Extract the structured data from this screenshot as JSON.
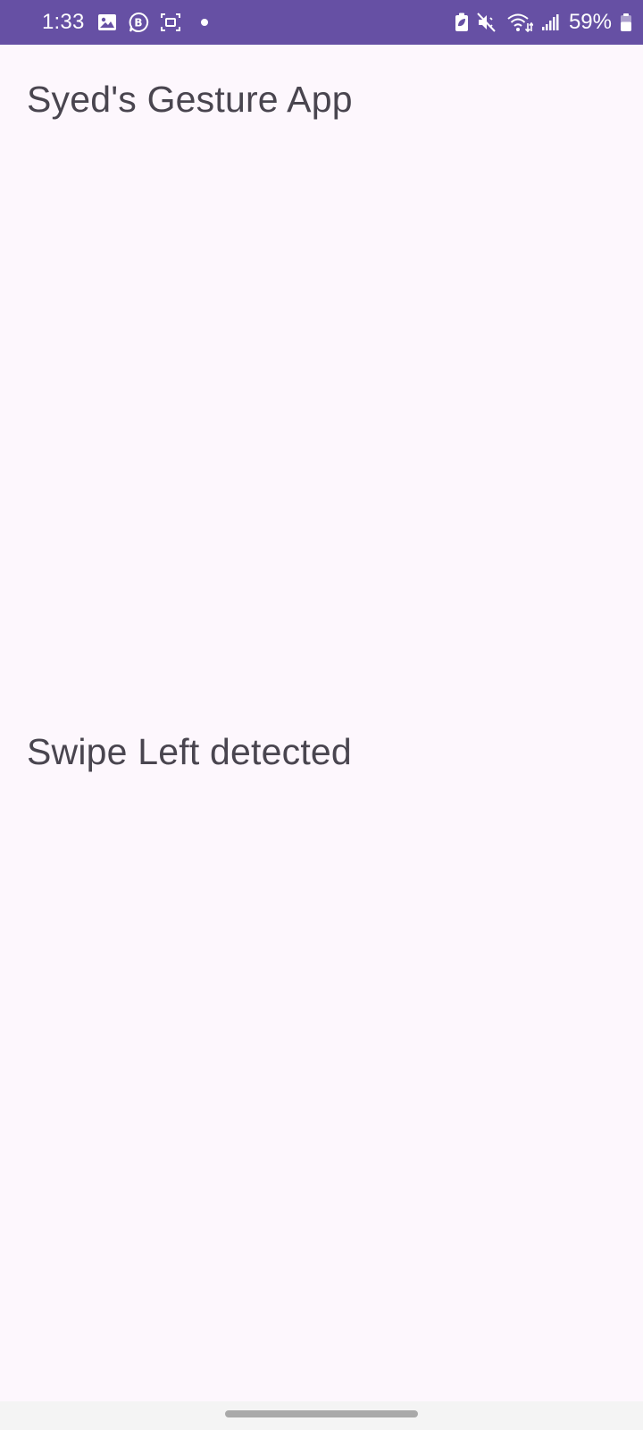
{
  "status_bar": {
    "time": "1:33",
    "battery_percent": "59%",
    "bg_color": "#6650a4",
    "left_icons": [
      "gallery-icon",
      "business-b-icon",
      "screen-capture-icon",
      "notification-dot-icon"
    ],
    "right_icons": [
      "battery-saver-icon",
      "mute-icon",
      "wifi-icon",
      "signal-icon",
      "battery-icon"
    ]
  },
  "app": {
    "title": "Syed's Gesture App",
    "gesture_status": "Swipe Left detected",
    "text_color": "#49454f",
    "bg_color": "#fdf7fd"
  },
  "nav_bar": {
    "handle_color": "#a9a9a9"
  }
}
